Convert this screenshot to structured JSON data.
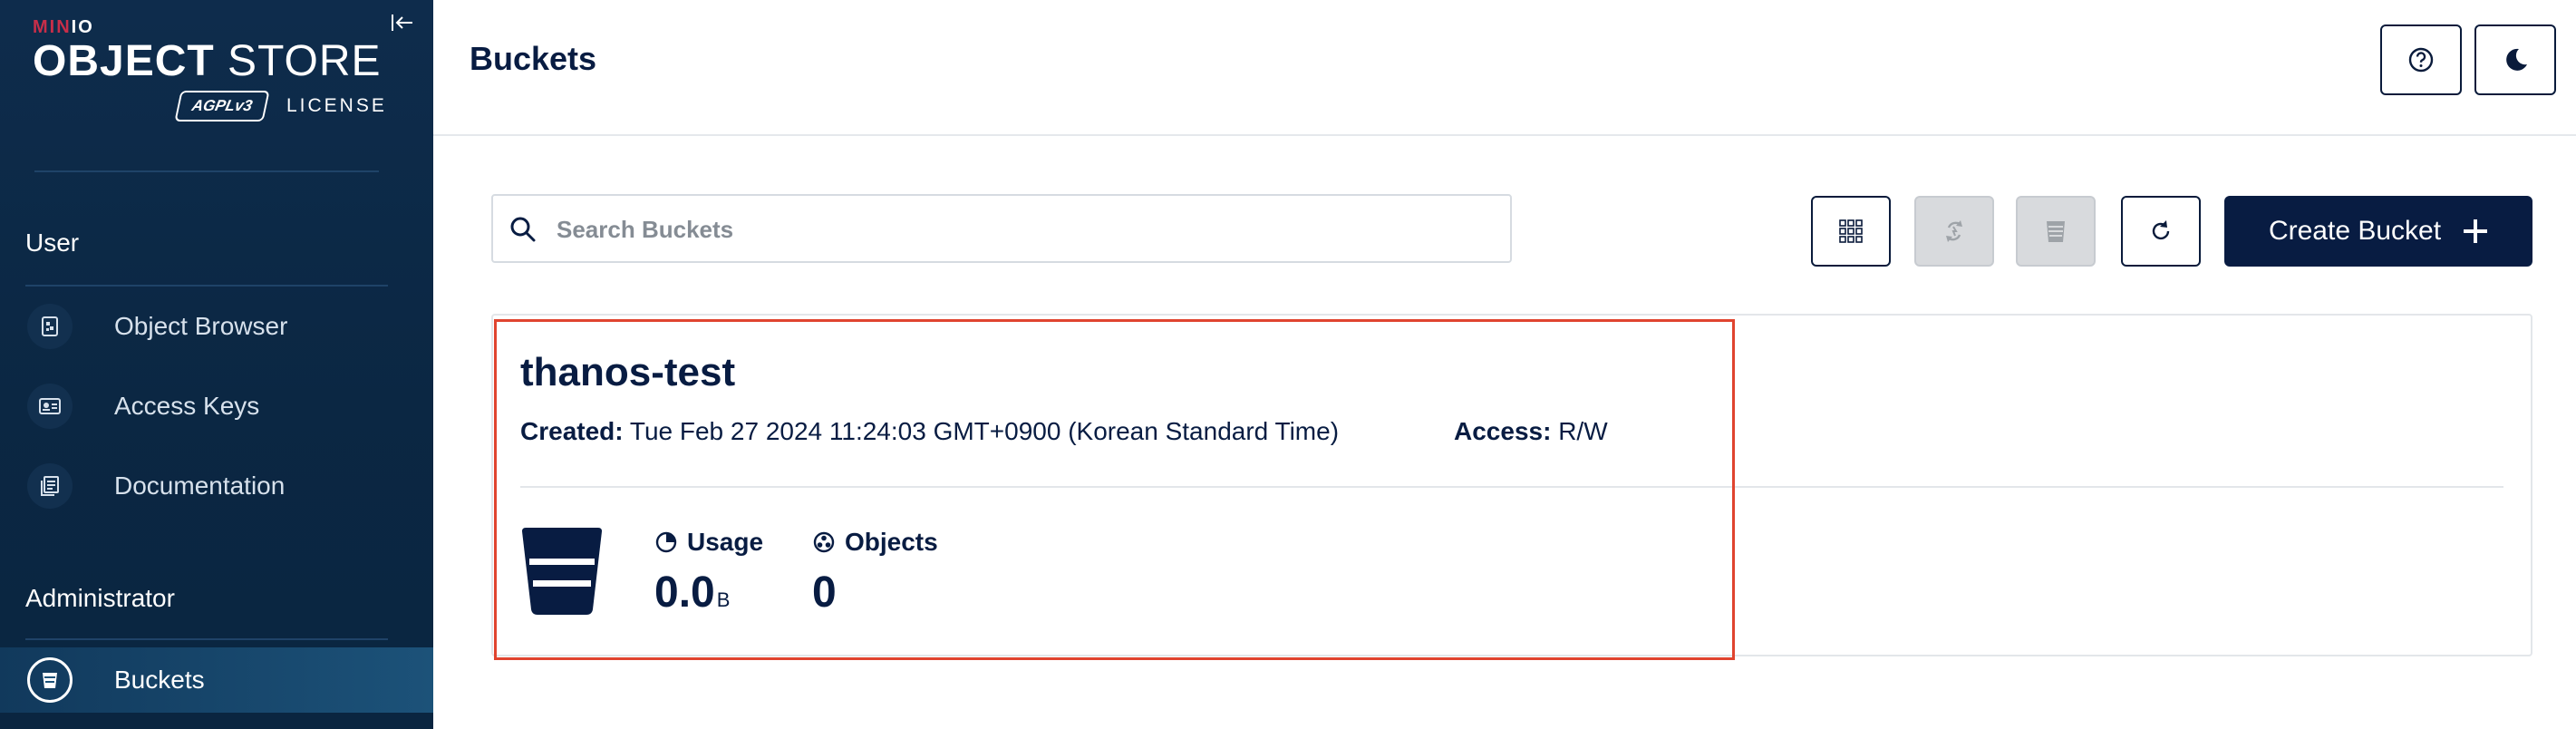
{
  "sidebar": {
    "brand": {
      "minio_main": "MIN",
      "minio_io": "IO",
      "object": "OBJECT",
      "store": "STORE",
      "agpl": "AGPLv3",
      "license": "LICENSE"
    },
    "sections": [
      {
        "label": "User"
      },
      {
        "label": "Administrator"
      }
    ],
    "items": [
      {
        "label": "Object Browser",
        "icon": "object-browser-icon"
      },
      {
        "label": "Access Keys",
        "icon": "access-keys-icon"
      },
      {
        "label": "Documentation",
        "icon": "documentation-icon"
      },
      {
        "label": "Buckets",
        "icon": "bucket-icon",
        "active": true
      }
    ]
  },
  "header": {
    "title": "Buckets",
    "buttons": [
      {
        "icon": "help-icon"
      },
      {
        "icon": "dark-mode-icon"
      }
    ]
  },
  "toolbar": {
    "search_placeholder": "Search Buckets",
    "search_value": "",
    "buttons": [
      {
        "icon": "grid-view-icon",
        "enabled": true
      },
      {
        "icon": "replication-icon",
        "enabled": false
      },
      {
        "icon": "lifecycle-icon",
        "enabled": false
      },
      {
        "icon": "refresh-icon",
        "enabled": true
      }
    ],
    "create_label": "Create Bucket"
  },
  "buckets": [
    {
      "name": "thanos-test",
      "created_label": "Created:",
      "created": "Tue Feb 27 2024 11:24:03 GMT+0900 (Korean Standard Time)",
      "access_label": "Access:",
      "access": "R/W",
      "usage_label": "Usage",
      "usage_value": "0.0",
      "usage_unit": "B",
      "objects_label": "Objects",
      "objects_value": "0"
    }
  ],
  "colors": {
    "sidebar_bg": "#0b2743",
    "primary": "#081c42",
    "brand_red": "#c72e49",
    "highlight": "#e0442f"
  }
}
